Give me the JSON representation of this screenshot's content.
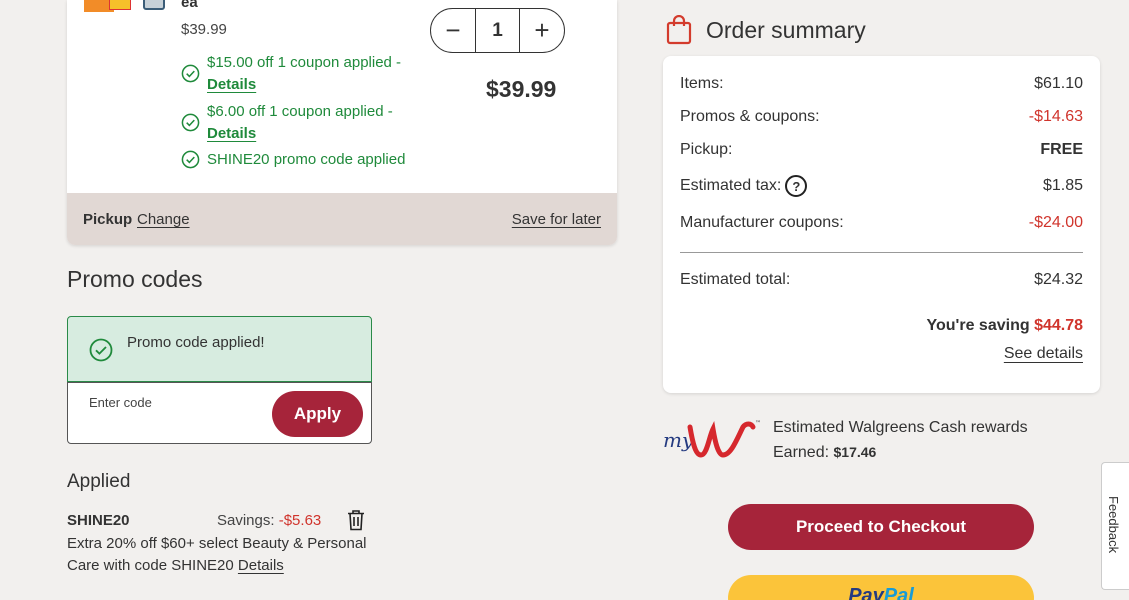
{
  "product": {
    "unit_suffix": "ea",
    "unit_price": "$39.99",
    "coupons": [
      {
        "text": "$15.00 off 1 coupon applied -",
        "link": "Details"
      },
      {
        "text": "$6.00 off 1 coupon applied -",
        "link": "Details"
      },
      {
        "text": "SHINE20 promo code applied",
        "link": ""
      }
    ],
    "quantity": "1",
    "decrease_symbol": "−",
    "increase_symbol": "+",
    "total_price": "$39.99",
    "fulfillment_label": "Pickup",
    "change_link": "Change",
    "save_for_later": "Save for later"
  },
  "promo": {
    "heading": "Promo codes",
    "success_message": "Promo code applied!",
    "input_placeholder": "Enter code",
    "apply_label": "Apply",
    "applied_heading": "Applied",
    "applied_code": "SHINE20",
    "savings_label": "Savings:",
    "savings_value": "-$5.63",
    "description": "Extra 20% off $60+ select Beauty & Personal Care with code SHINE20",
    "details_link": "Details"
  },
  "summary": {
    "heading": "Order summary",
    "rows": [
      {
        "label": "Items:",
        "value": "$61.10"
      },
      {
        "label": "Promos & coupons:",
        "value": "-$14.63"
      },
      {
        "label": "Pickup:",
        "value": "FREE"
      },
      {
        "label": "Estimated tax:",
        "value": "$1.85"
      },
      {
        "label": "Manufacturer coupons:",
        "value": "-$24.00"
      }
    ],
    "tax_help_symbol": "?",
    "total_label": "Estimated total:",
    "total_value": "$24.32",
    "saving_label": "You're saving",
    "saving_value": "$44.78",
    "see_details": "See details"
  },
  "rewards": {
    "line1": "Estimated Walgreens Cash rewards",
    "earned_label": "Earned:",
    "earned_value": "$17.46"
  },
  "actions": {
    "checkout_label": "Proceed to Checkout",
    "paypal_pay": "Pay",
    "paypal_pal": "Pal"
  },
  "feedback_label": "Feedback",
  "colors": {
    "brand_red": "#a6243a",
    "success_green": "#1f8a3b",
    "discount_red": "#d0342c",
    "paypal_yellow": "#fbc43a"
  },
  "icons": [
    "product-thumbnail",
    "check-circle-icon",
    "shopping-bag-icon",
    "question-icon",
    "trash-icon",
    "mywalgreens-logo"
  ]
}
